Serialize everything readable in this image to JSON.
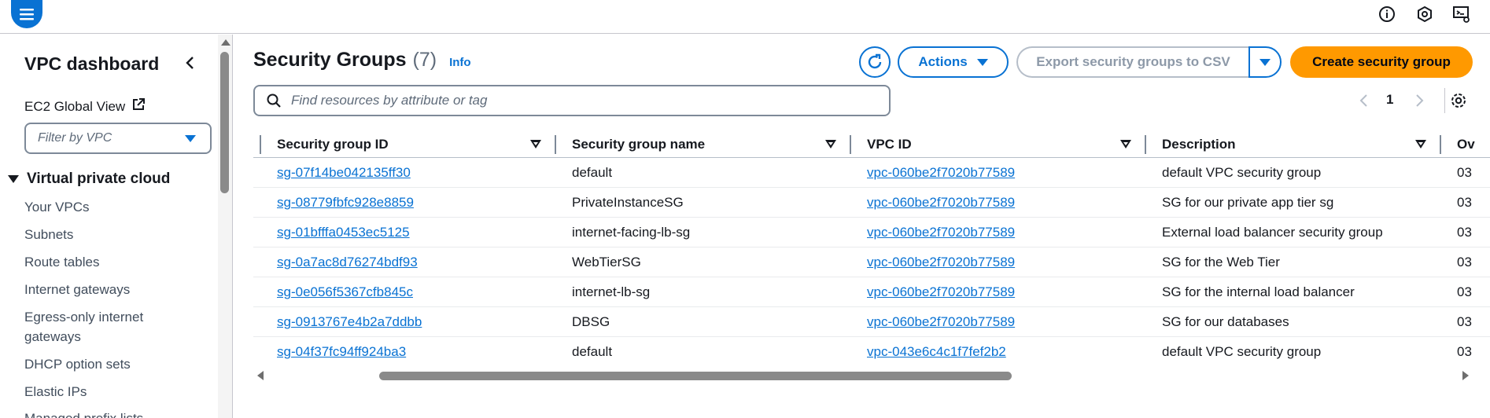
{
  "topbar": {
    "icons": [
      "menu-icon",
      "info-circle-icon",
      "notifications-icon",
      "cloudshell-icon"
    ]
  },
  "sidebar": {
    "title": "VPC dashboard",
    "ec2_global_view": "EC2 Global View",
    "filter_placeholder": "Filter by VPC",
    "section_title": "Virtual private cloud",
    "items": [
      {
        "label": "Your VPCs"
      },
      {
        "label": "Subnets"
      },
      {
        "label": "Route tables"
      },
      {
        "label": "Internet gateways"
      },
      {
        "label": "Egress-only internet gateways"
      },
      {
        "label": "DHCP option sets"
      },
      {
        "label": "Elastic IPs"
      },
      {
        "label": "Managed prefix lists"
      }
    ]
  },
  "header": {
    "title": "Security Groups",
    "count": "(7)",
    "info_label": "Info",
    "actions_label": "Actions",
    "export_label": "Export security groups to CSV",
    "create_label": "Create security group",
    "search_placeholder": "Find resources by attribute or tag",
    "page_number": "1"
  },
  "table": {
    "columns": [
      "Security group ID",
      "Security group name",
      "VPC ID",
      "Description",
      "Ov"
    ],
    "rows": [
      {
        "id": "sg-07f14be042135ff30",
        "name": "default",
        "vpc": "vpc-060be2f7020b77589",
        "description": "default VPC security group",
        "owner": "03"
      },
      {
        "id": "sg-08779fbfc928e8859",
        "name": "PrivateInstanceSG",
        "vpc": "vpc-060be2f7020b77589",
        "description": "SG for our private app tier sg",
        "owner": "03"
      },
      {
        "id": "sg-01bfffa0453ec5125",
        "name": "internet-facing-lb-sg",
        "vpc": "vpc-060be2f7020b77589",
        "description": "External load balancer security group",
        "owner": "03"
      },
      {
        "id": "sg-0a7ac8d76274bdf93",
        "name": "WebTierSG",
        "vpc": "vpc-060be2f7020b77589",
        "description": "SG for the Web Tier",
        "owner": "03"
      },
      {
        "id": "sg-0e056f5367cfb845c",
        "name": "internet-lb-sg",
        "vpc": "vpc-060be2f7020b77589",
        "description": "SG for the internal load balancer",
        "owner": "03"
      },
      {
        "id": "sg-0913767e4b2a7ddbb",
        "name": "DBSG",
        "vpc": "vpc-060be2f7020b77589",
        "description": "SG for our databases",
        "owner": "03"
      },
      {
        "id": "sg-04f37fc94ff924ba3",
        "name": "default",
        "vpc": "vpc-043e6c4c1f7fef2b2",
        "description": "default VPC security group",
        "owner": "03"
      }
    ]
  },
  "colors": {
    "link": "#0972d3",
    "primary_button": "#ff9900",
    "text": "#16191f"
  }
}
